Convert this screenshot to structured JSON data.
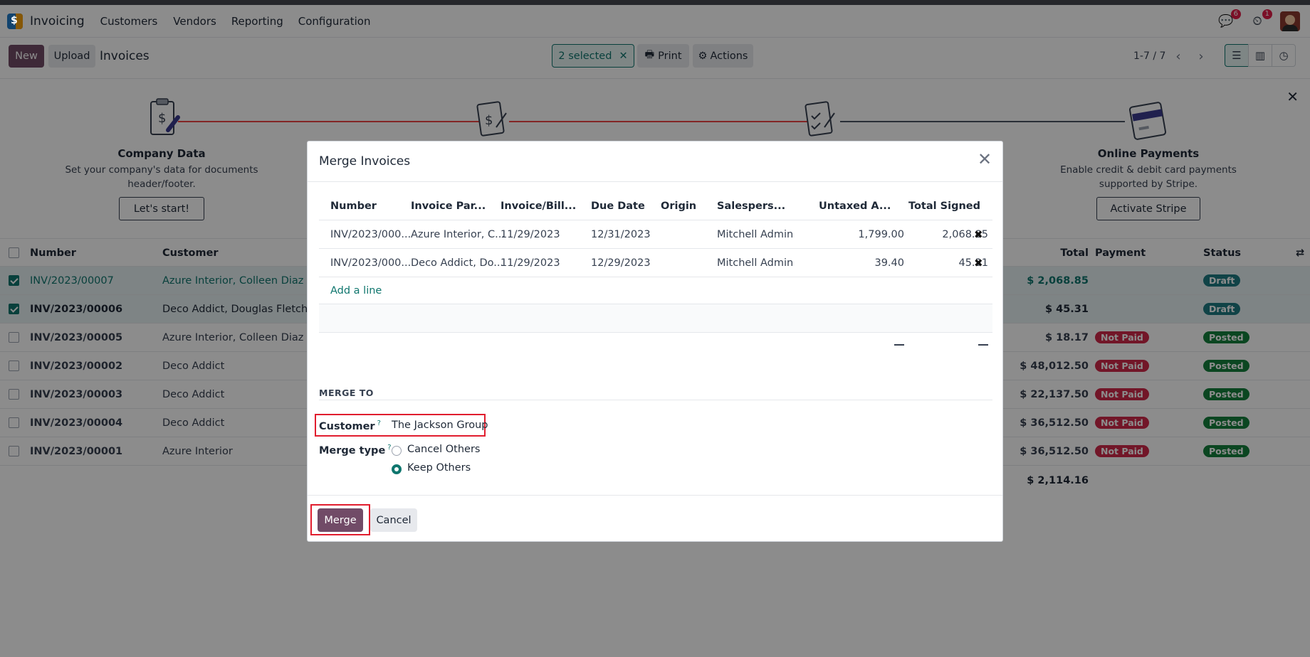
{
  "navbar": {
    "app_name": "Invoicing",
    "menus": [
      "Customers",
      "Vendors",
      "Reporting",
      "Configuration"
    ],
    "messages_count": "6",
    "activities_count": "1"
  },
  "control_panel": {
    "new_label": "New",
    "upload_label": "Upload",
    "title": "Invoices",
    "selected_label": "2 selected",
    "print_label": "Print",
    "actions_label": "Actions",
    "pager": "1-7 / 7"
  },
  "onboarding": {
    "steps": [
      {
        "title": "Company Data",
        "desc_line1": "Set your company's data for documents",
        "desc_line2": "header/footer.",
        "button": "Let's start!"
      },
      {
        "title": "Online Payments",
        "desc_line1": "Enable credit & debit card payments",
        "desc_line2": "supported by Stripe.",
        "button": "Activate Stripe"
      }
    ]
  },
  "list": {
    "headers": {
      "number": "Number",
      "customer": "Customer",
      "total": "Total",
      "payment": "Payment",
      "status": "Status"
    },
    "rows": [
      {
        "number": "INV/2023/00007",
        "customer": "Azure Interior, Colleen Diaz",
        "total": "$ 2,068.85",
        "payment": "",
        "status": "Draft",
        "selected": true
      },
      {
        "number": "INV/2023/00006",
        "customer": "Deco Addict, Douglas Fletcher",
        "total": "$ 45.31",
        "payment": "",
        "status": "Draft",
        "selected": true
      },
      {
        "number": "INV/2023/00005",
        "customer": "Azure Interior, Colleen Diaz",
        "total": "$ 18.17",
        "payment": "Not Paid",
        "status": "Posted",
        "selected": false
      },
      {
        "number": "INV/2023/00002",
        "customer": "Deco Addict",
        "total": "$ 48,012.50",
        "payment": "Not Paid",
        "status": "Posted",
        "selected": false
      },
      {
        "number": "INV/2023/00003",
        "customer": "Deco Addict",
        "total": "$ 22,137.50",
        "payment": "Not Paid",
        "status": "Posted",
        "selected": false
      },
      {
        "number": "INV/2023/00004",
        "customer": "Deco Addict",
        "total": "$ 36,512.50",
        "payment": "Not Paid",
        "status": "Posted",
        "selected": false
      },
      {
        "number": "INV/2023/00001",
        "customer": "Azure Interior",
        "total": "$ 36,512.50",
        "payment": "Not Paid",
        "status": "Posted",
        "selected": false
      }
    ],
    "footer_total": "$ 2,114.16"
  },
  "modal": {
    "title": "Merge Invoices",
    "table": {
      "headers": [
        "Number",
        "Invoice Par...",
        "Invoice/Bill...",
        "Due Date",
        "Origin",
        "Salespers...",
        "Untaxed A...",
        "Total Signed"
      ],
      "rows": [
        {
          "number": "INV/2023/000...",
          "partner": "Azure Interior, C...",
          "invoice_date": "11/29/2023",
          "due_date": "12/31/2023",
          "origin": "",
          "salesperson": "Mitchell Admin",
          "untaxed": "1,799.00",
          "total_signed": "2,068.85"
        },
        {
          "number": "INV/2023/000...",
          "partner": "Deco Addict, Do...",
          "invoice_date": "11/29/2023",
          "due_date": "12/29/2023",
          "origin": "",
          "salesperson": "Mitchell Admin",
          "untaxed": "39.40",
          "total_signed": "45.31"
        }
      ],
      "add_line": "Add a line"
    },
    "section_label": "MERGE TO",
    "customer_label": "Customer",
    "customer_value": "The Jackson Group",
    "merge_type_label": "Merge type",
    "help_mark": "?",
    "options": [
      {
        "label": "Cancel Others",
        "checked": false
      },
      {
        "label": "Keep Others",
        "checked": true
      }
    ],
    "merge_button": "Merge",
    "cancel_button": "Cancel"
  },
  "colors": {
    "brand": "#714b67",
    "teal": "#0f766e",
    "highlight": "#e11d2e"
  }
}
